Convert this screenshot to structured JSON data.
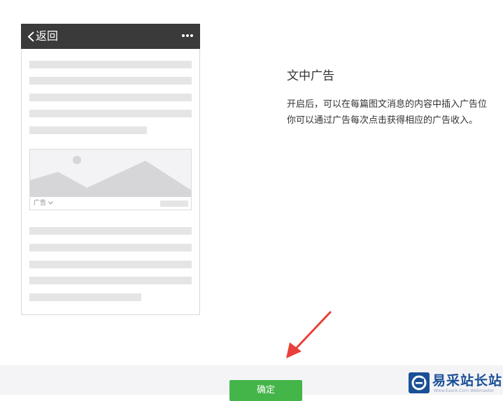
{
  "phone_preview": {
    "back_label": "返回",
    "back_icon": "chevron-left-icon",
    "more_icon": "more-dots-icon",
    "ad_label": "广告",
    "ad_image_icon": "landscape-image-icon"
  },
  "info": {
    "title": "文中广告",
    "description_line1": "开启后，可以在每篇图文消息的内容中插入广告位",
    "description_line2": "你可以通过广告每次点击获得相应的广告收入。"
  },
  "footer": {
    "confirm_label": "确定"
  },
  "watermark": {
    "name": "易采站长站",
    "sub": "Www.Easck.Com  Webmaster"
  },
  "colors": {
    "phone_bar": "#3a3a3a",
    "confirm_button": "#44b549",
    "arrow": "#e8403a",
    "footer_bg": "#f4f4f6"
  }
}
